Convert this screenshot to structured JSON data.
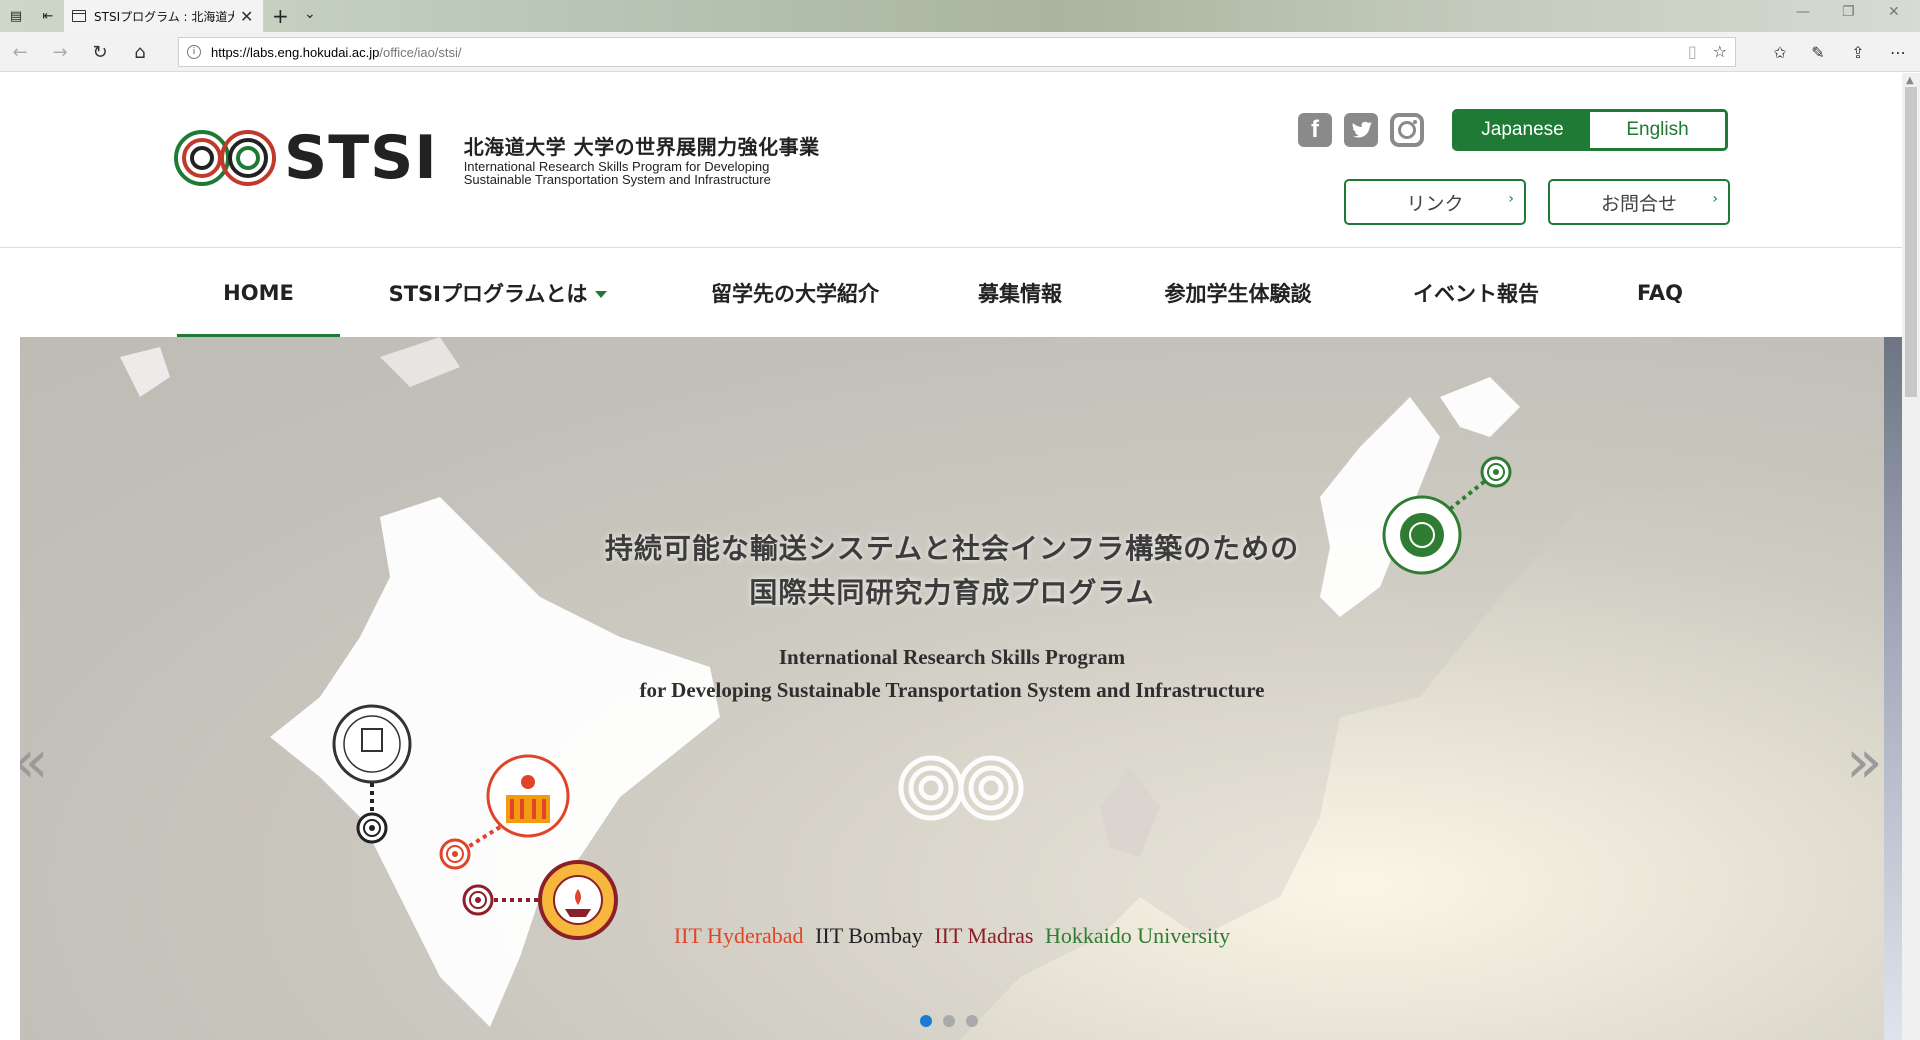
{
  "browser": {
    "tab_title": "STSIプログラム : 北海道大",
    "url_host": "https://labs.eng.hokudai.ac.jp",
    "url_path": "/office/iao/stsi/"
  },
  "header": {
    "logo_text": "STSI",
    "logo_jp": "北海道大学 大学の世界展開力強化事業",
    "logo_en_1": "International Research Skills Program for Developing",
    "logo_en_2": "Sustainable Transportation System and Infrastructure",
    "lang_japanese": "Japanese",
    "lang_english": "English",
    "link_button": "リンク",
    "contact_button": "お問合せ"
  },
  "nav": {
    "home": "HOME",
    "about": "STSIプログラムとは",
    "universities": "留学先の大学紹介",
    "recruit": "募集情報",
    "experience": "参加学生体験談",
    "events": "イベント報告",
    "faq": "FAQ"
  },
  "hero": {
    "title_1": "持続可能な輸送システムと社会インフラ構築のための",
    "title_2": "国際共同研究力育成プログラム",
    "sub_1": "International Research Skills Program",
    "sub_2": "for Developing Sustainable Transportation System and Infrastructure",
    "uni_1": "IIT Hyderabad",
    "uni_2": "IIT Bombay",
    "uni_3": "IIT Madras",
    "uni_4": "Hokkaido University",
    "prev": "«",
    "next": "»"
  },
  "colors": {
    "brand_green": "#1e7a34",
    "hyderabad": "#e0452a",
    "bombay": "#222222",
    "madras": "#8b1f2a",
    "hokkaido": "#2e7d32"
  }
}
